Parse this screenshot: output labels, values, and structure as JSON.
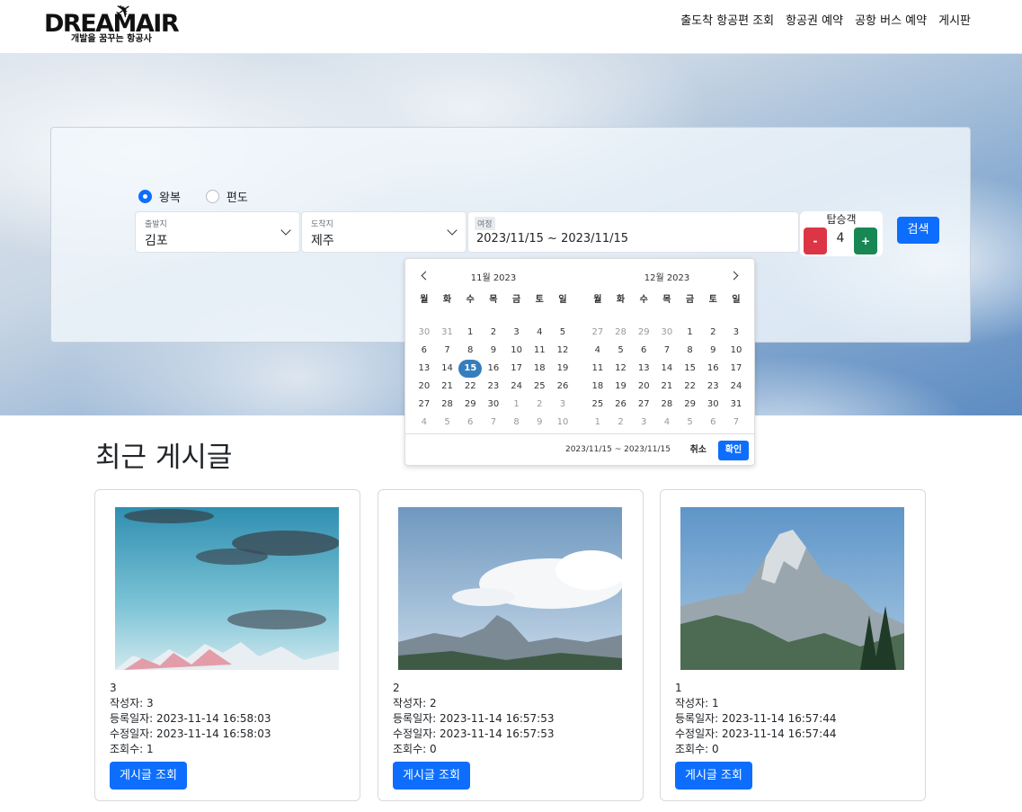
{
  "brand": {
    "name": "DREAMAIR",
    "tagline": "개발을 꿈꾸는 항공사"
  },
  "nav": [
    "출도착 항공편 조회",
    "항공권 예약",
    "공항 버스 예약",
    "게시판"
  ],
  "search": {
    "trip_types": [
      {
        "label": "왕복",
        "selected": true
      },
      {
        "label": "편도",
        "selected": false
      }
    ],
    "departure": {
      "label": "출발지",
      "value": "김포"
    },
    "arrival": {
      "label": "도착지",
      "value": "제주"
    },
    "trip": {
      "label": "여정",
      "value": "2023/11/15 ~ 2023/11/15"
    },
    "passengers": {
      "label": "탑승객",
      "count": "4",
      "minus": "-",
      "plus": "+"
    },
    "search_button": "검색"
  },
  "calendar": {
    "weekdays": [
      "월",
      "화",
      "수",
      "목",
      "금",
      "토",
      "일"
    ],
    "months": [
      {
        "title": "11월 2023",
        "weeks": [
          [
            "30",
            "31",
            "1",
            "2",
            "3",
            "4",
            "5"
          ],
          [
            "6",
            "7",
            "8",
            "9",
            "10",
            "11",
            "12"
          ],
          [
            "13",
            "14",
            "15",
            "16",
            "17",
            "18",
            "19"
          ],
          [
            "20",
            "21",
            "22",
            "23",
            "24",
            "25",
            "26"
          ],
          [
            "27",
            "28",
            "29",
            "30",
            "1",
            "2",
            "3"
          ],
          [
            "4",
            "5",
            "6",
            "7",
            "8",
            "9",
            "10"
          ]
        ]
      },
      {
        "title": "12월 2023",
        "weeks": [
          [
            "27",
            "28",
            "29",
            "30",
            "1",
            "2",
            "3"
          ],
          [
            "4",
            "5",
            "6",
            "7",
            "8",
            "9",
            "10"
          ],
          [
            "11",
            "12",
            "13",
            "14",
            "15",
            "16",
            "17"
          ],
          [
            "18",
            "19",
            "20",
            "21",
            "22",
            "23",
            "24"
          ],
          [
            "25",
            "26",
            "27",
            "28",
            "29",
            "30",
            "31"
          ],
          [
            "1",
            "2",
            "3",
            "4",
            "5",
            "6",
            "7"
          ]
        ]
      }
    ],
    "selected_day": "15",
    "range_text": "2023/11/15 ~ 2023/11/15",
    "cancel": "취소",
    "apply": "확인"
  },
  "recent": {
    "title": "최근 게시글",
    "view_button": "게시글 조회",
    "posts": [
      {
        "no": "3",
        "author": "작성자: 3",
        "created": "등록일자: 2023-11-14 16:58:03",
        "updated": "수정일자: 2023-11-14 16:58:03",
        "views": "조회수: 1"
      },
      {
        "no": "2",
        "author": "작성자: 2",
        "created": "등록일자: 2023-11-14 16:57:53",
        "updated": "수정일자: 2023-11-14 16:57:53",
        "views": "조회수: 0"
      },
      {
        "no": "1",
        "author": "작성자: 1",
        "created": "등록일자: 2023-11-14 16:57:44",
        "updated": "수정일자: 2023-11-14 16:57:44",
        "views": "조회수: 0"
      }
    ]
  }
}
